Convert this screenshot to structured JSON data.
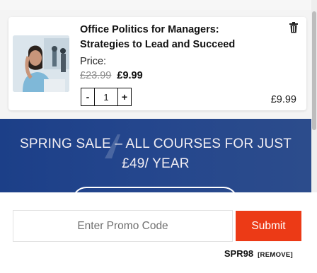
{
  "cart": {
    "item": {
      "title": "Office Politics for Managers: Strategies to Lead and Succeed",
      "price_label": "Price:",
      "original_price": "£23.99",
      "sale_price": "£9.99",
      "quantity": "1",
      "decrement_label": "-",
      "increment_label": "+",
      "line_total": "£9.99",
      "thumbnail_icon": "course-thumbnail-photo",
      "delete_icon": "trash-icon"
    }
  },
  "banner": {
    "line1": "SPRING SALE – ALL COURSES FOR JUST",
    "line2": "£49/ YEAR"
  },
  "promo": {
    "placeholder": "Enter Promo Code",
    "submit_label": "Submit",
    "applied_code": "SPR98",
    "remove_label": "[REMOVE]"
  },
  "colors": {
    "submit_button": "#ec3a16",
    "banner_bg": "#24468d"
  }
}
